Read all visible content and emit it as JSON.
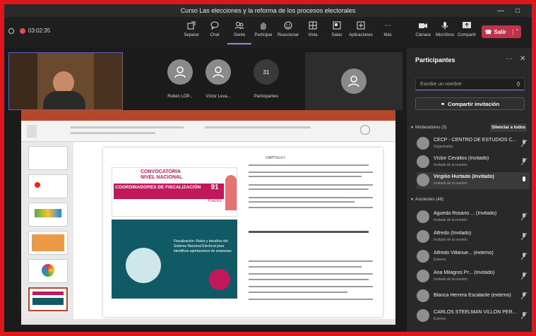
{
  "window": {
    "title": "Curso Las elecciones y la reforma de los procesos electorales"
  },
  "toolbar": {
    "timer": "03:02:35",
    "buttons": [
      {
        "label": "Separar",
        "icon": "pop-out-icon"
      },
      {
        "label": "Chat",
        "icon": "chat-icon"
      },
      {
        "label": "Gente",
        "icon": "people-icon"
      },
      {
        "label": "Participar",
        "icon": "raise-hand-icon"
      },
      {
        "label": "Reaccionar",
        "icon": "react-icon"
      },
      {
        "label": "Vista",
        "icon": "view-icon"
      },
      {
        "label": "Salas",
        "icon": "rooms-icon"
      },
      {
        "label": "Aplicaciones",
        "icon": "apps-icon"
      },
      {
        "label": "Más",
        "icon": "more-icon"
      },
      {
        "label": "Cámara",
        "icon": "camera-icon"
      },
      {
        "label": "Micrófono",
        "icon": "microphone-icon"
      },
      {
        "label": "Compartir",
        "icon": "share-icon"
      }
    ],
    "leave_label": "Salir"
  },
  "stage": {
    "tiles": [
      {
        "name": "Rubén LÓP...",
        "initials": ""
      },
      {
        "name": "Víctor Leva...",
        "initials": ""
      },
      {
        "name": "Participantes",
        "initials": "31"
      }
    ]
  },
  "panel": {
    "title": "Participantes",
    "search_placeholder": "Escribe un nombre",
    "share_invite": "Compartir invitación",
    "moderators_header": "Moderadores (3)",
    "mute_all": "Silenciar a todos",
    "attendees_header": "Asistentes (48)",
    "moderators": [
      {
        "name": "CECP - CENTRO DE ESTUDIOS C...",
        "role": "Organizador"
      },
      {
        "name": "Víctor Cevallos (Invitado)",
        "role": "Invitado de la reunión"
      },
      {
        "name": "Virgilio Hurtado (Invitado)",
        "role": "Invitado de la reunión"
      }
    ],
    "attendees": [
      {
        "name": "Agueda Rosario ... (Invitado)",
        "role": "Invitado de la reunión"
      },
      {
        "name": "Alfredo (Invitado)",
        "role": "Invitado de la reunión"
      },
      {
        "name": "Alfredo Villanue... (externo)",
        "role": "Externo"
      },
      {
        "name": "Ana Milagros Pr... (Invitado)",
        "role": "Invitado de la reunión"
      },
      {
        "name": "Blanca Herrera Escalante (externo)",
        "role": ""
      },
      {
        "name": "CARLOS STEELMAN VILLON PER...",
        "role": "Externo"
      }
    ]
  },
  "presentation": {
    "poster1_line1": "CONVOCATORIA",
    "poster1_line2": "NIVEL NACIONAL",
    "poster1_line3": "COORDINADORES DE FISCALIZACIÓN",
    "poster1_badge": "91",
    "poster1_badge_sub": "PLAZAS",
    "poster2_text": "Fiscalización: Retos y desafíos del Sistema Nacional Electoral para identificar aportaciones de empresas",
    "doc_heading": "CAPÍTULO I"
  },
  "colors": {
    "accent": "#5b5fc7",
    "leave": "#c4314b",
    "border": "#e0161c",
    "powerpoint": "#b7472a"
  }
}
